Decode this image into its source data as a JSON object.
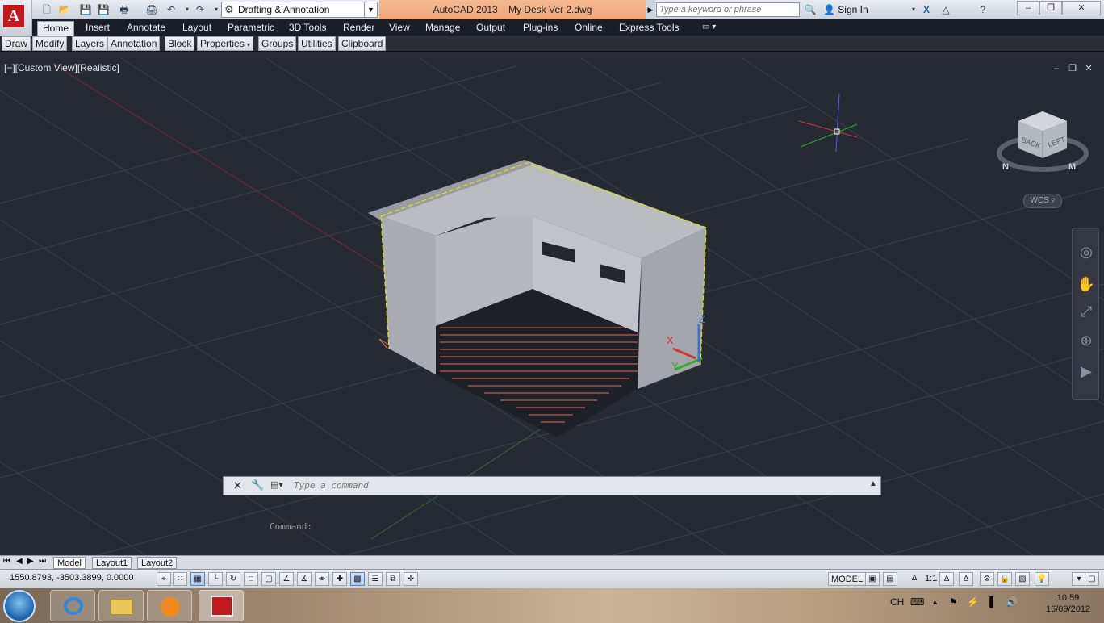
{
  "app": {
    "logo_letter": "A",
    "title": "AutoCAD 2013",
    "document": "My Desk Ver 2.dwg",
    "workspace": "Drafting & Annotation",
    "search_placeholder": "Type a keyword or phrase",
    "sign_in": "Sign In"
  },
  "ribbon": {
    "tabs": [
      "Home",
      "Insert",
      "Annotate",
      "Layout",
      "Parametric",
      "3D Tools",
      "Render",
      "View",
      "Manage",
      "Output",
      "Plug-ins",
      "Online",
      "Express Tools"
    ],
    "active_tab": "Home",
    "panels": [
      "Draw",
      "Modify",
      "Layers",
      "Annotation",
      "Block",
      "Properties",
      "Groups",
      "Utilities",
      "Clipboard"
    ]
  },
  "viewport": {
    "label": "[−][Custom View][Realistic]",
    "viewcube_faces": [
      "BACK",
      "LEFT"
    ],
    "compass_letters": [
      "N",
      "M"
    ],
    "wcs": "WCS",
    "axis_labels": [
      "X",
      "Y",
      "Z"
    ]
  },
  "command": {
    "history": "Command:",
    "placeholder": "Type a command"
  },
  "layout_tabs": [
    "Model",
    "Layout1",
    "Layout2"
  ],
  "status": {
    "coords": "1550.8793, -3503.3899, 0.0000",
    "model": "MODEL",
    "scale": "1:1"
  },
  "taskbar": {
    "language": "CH",
    "time": "10:59",
    "date": "16/09/2012"
  },
  "colors": {
    "viewport_bg": "#262a33",
    "ribbon_bg": "#1a1e27",
    "title_accent": "#f0a878",
    "hatch": "#e0705a",
    "selection": "#ffff00"
  }
}
